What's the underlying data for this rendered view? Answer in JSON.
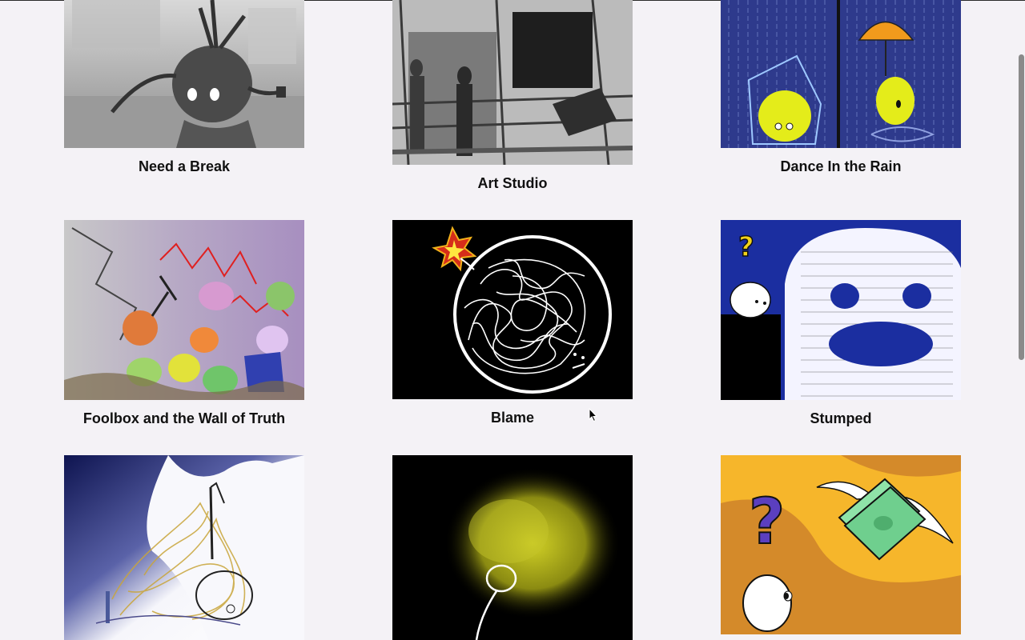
{
  "gallery": {
    "items": [
      {
        "title": "Need a Break"
      },
      {
        "title": "Art Studio"
      },
      {
        "title": "Dance In the Rain"
      },
      {
        "title": "Foolbox and the Wall of Truth"
      },
      {
        "title": "Blame"
      },
      {
        "title": "Stumped"
      },
      {
        "title": ""
      },
      {
        "title": ""
      },
      {
        "title": ""
      }
    ]
  },
  "colors": {
    "background": "#f4f2f6",
    "caption": "#111111",
    "rain_blue": "#2e3a8c",
    "doodle_yellow": "#e4ec1a",
    "umbrella_orange": "#f29a1c",
    "cash_green": "#8fe3a8",
    "amber": "#f6b62b",
    "question_purple": "#5b3fbf"
  }
}
